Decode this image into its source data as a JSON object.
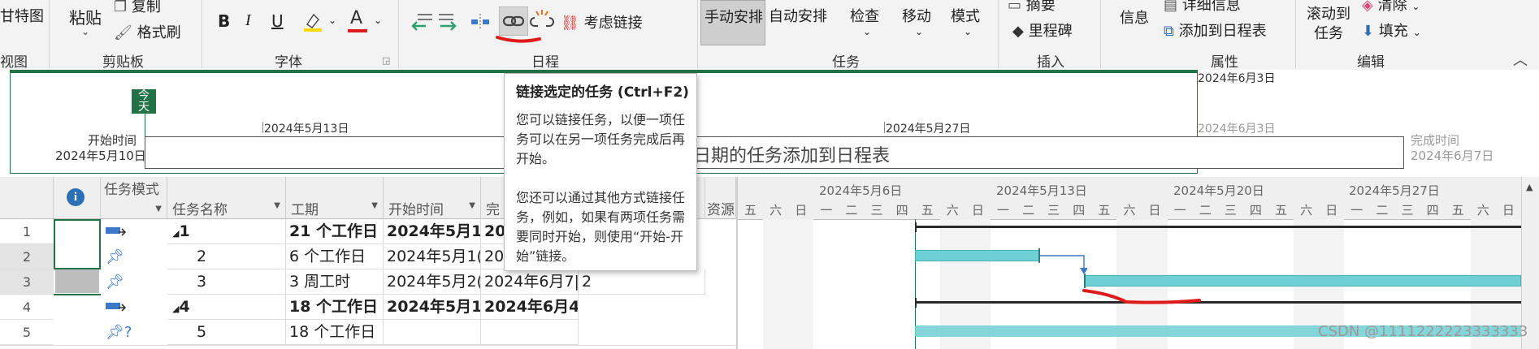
{
  "ribbon": {
    "gantt_view_label": "甘特图",
    "view_group": "视图",
    "paste_label": "粘贴",
    "copy_label": "复制",
    "format_painter_label": "格式刷",
    "clipboard_group": "剪贴板",
    "bold": "B",
    "italic": "I",
    "underline": "U",
    "font_color": "A",
    "font_group": "字体",
    "respect_links_label": "考虑链接",
    "schedule_group": "日程",
    "manual_schedule_label": "手动安排",
    "auto_schedule_label": "自动安排",
    "inspect_label": "检查",
    "move_label": "移动",
    "mode_label": "模式",
    "tasks_group": "任务",
    "summary_label": "摘要",
    "milestone_label": "里程碑",
    "insert_group": "插入",
    "info_label": "信息",
    "details_label": "详细信息",
    "add_to_timeline_label": "添加到日程表",
    "properties_group": "属性",
    "scroll_to_task_label_1": "滚动到",
    "scroll_to_task_label_2": "任务",
    "clear_label": "清除",
    "fill_label": "填充",
    "editing_group": "编辑"
  },
  "tooltip": {
    "title": "链接选定的任务 (Ctrl+F2)",
    "para1": "您可以链接任务，以便一项任务可以在另一项任务完成后再开始。",
    "para2": "您还可以通过其他方式链接任务，例如，如果有两项任务需要同时开始，则使用“开始-开始”链接。"
  },
  "timeline": {
    "today_1": "今",
    "today_2": "天",
    "start_label": "开始时间",
    "start_date": "2024年5月10日",
    "tick_1": "2024年5月13日",
    "tick_2": "2024年5月27日",
    "tick_3": "2024年6月3日",
    "tick_top": "2024年6月3日",
    "placeholder": "日期的任务添加到日程表",
    "finish_label": "完成时间",
    "finish_date": "2024年6月7日"
  },
  "grid": {
    "headers": {
      "mode": "任务模式",
      "name": "任务名称",
      "duration": "工期",
      "start": "开始时间",
      "finish": "完",
      "resource": "资源"
    },
    "rows": [
      {
        "num": "1",
        "name": "1",
        "duration": "21 个工作日",
        "start": "2024年5月1(",
        "finish": "20",
        "pred": ""
      },
      {
        "num": "2",
        "name": "2",
        "duration": "6 个工作日",
        "start": "2024年5月1(",
        "finish": "20",
        "pred": ""
      },
      {
        "num": "3",
        "name": "3",
        "duration": "3 周工时",
        "start": "2024年5月2(",
        "finish": "2024年6月7|",
        "pred": "2"
      },
      {
        "num": "4",
        "name": "4",
        "duration": "18 个工作日",
        "start": "2024年5月1(",
        "finish": "2024年6月4|",
        "pred": ""
      },
      {
        "num": "5",
        "name": "5",
        "duration": "18 个工作日",
        "start": "",
        "finish": "",
        "pred": ""
      }
    ]
  },
  "gantt": {
    "weeks": [
      "2024年5月6日",
      "2024年5月13日",
      "2024年5月20日",
      "2024年5月27日"
    ],
    "days": [
      "五",
      "六",
      "日",
      "一",
      "二",
      "三",
      "四",
      "五",
      "六",
      "日",
      "一",
      "二",
      "三",
      "四",
      "五",
      "六",
      "日",
      "一",
      "二",
      "三",
      "四",
      "五",
      "六",
      "日",
      "一",
      "二",
      "三",
      "四",
      "五",
      "六",
      "日"
    ]
  },
  "watermark": "CSDN @1111222223333333",
  "colors": {
    "accent": "#217346",
    "bar": "#6ecfd4",
    "dark_bar": "#2a2a2a",
    "annotation": "#e01b1b"
  }
}
